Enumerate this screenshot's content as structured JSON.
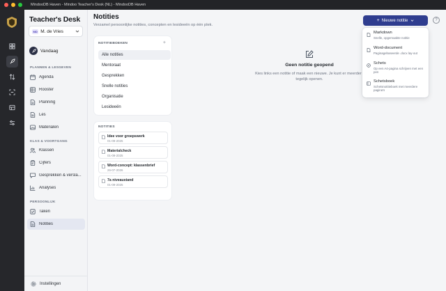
{
  "window": {
    "title": "MindooDB Haven - Mindoo Teacher's Desk (NL) - MindooDB Haven"
  },
  "sidebar": {
    "brand": "Teacher's Desk",
    "user": {
      "initials": "MD",
      "name": "M. de Vries"
    },
    "today_label": "Vandaag",
    "sections": [
      {
        "title": "PLANNEN & LESGEVEN",
        "items": [
          {
            "label": "Agenda",
            "icon": "calendar-icon"
          },
          {
            "label": "Rooster",
            "icon": "grid-icon"
          },
          {
            "label": "Planning",
            "icon": "file-icon"
          },
          {
            "label": "Les",
            "icon": "file-icon"
          },
          {
            "label": "Materialen",
            "icon": "image-icon"
          }
        ]
      },
      {
        "title": "KLAS & VOORTGANG",
        "items": [
          {
            "label": "Klassen",
            "icon": "users-icon"
          },
          {
            "label": "Cijfers",
            "icon": "clipboard-icon"
          },
          {
            "label": "Gesprekken & versla...",
            "icon": "chat-icon"
          },
          {
            "label": "Analyses",
            "icon": "chart-icon"
          }
        ]
      },
      {
        "title": "PERSOONLIJK",
        "items": [
          {
            "label": "Taken",
            "icon": "checkbox-icon"
          },
          {
            "label": "Notities",
            "icon": "note-icon",
            "active": true
          }
        ]
      }
    ],
    "settings_label": "Instellingen"
  },
  "main": {
    "title": "Notities",
    "subtitle": "Verzamel persoonlijke notities, concepten en lesideeën op één plek.",
    "new_note_button": "Nieuwe notitie",
    "help_label": "?",
    "folders": {
      "heading": "NOTITIEBOEKEN",
      "add_label": "+",
      "items": [
        "Alle notities",
        "Mentoraat",
        "Gesprekken",
        "Snelle notities",
        "Organisatie",
        "Lesideeën"
      ],
      "active_index": 0
    },
    "notes": {
      "heading": "NOTITIES",
      "items": [
        {
          "title": "Idee voor groepswerk",
          "date": "01-09-2025"
        },
        {
          "title": "Materialcheck",
          "date": "01-09-2025"
        },
        {
          "title": "Word-concept: klassenbrief",
          "date": "26-07-2026"
        },
        {
          "title": "7a niveaustand",
          "date": "01-09-2025"
        }
      ]
    },
    "empty_state": {
      "title": "Geen notitie geopend",
      "text": "Kies links een notitie of maak een nieuwe. Je kunt er meerdere tegelijk openen."
    },
    "new_menu": {
      "items": [
        {
          "title": "Markdown",
          "desc": "Snelle, opgemaakte notitie"
        },
        {
          "title": "Word-document",
          "desc": "Paginagebaseerde .docx lay-out"
        },
        {
          "title": "Schets",
          "desc": "Op een A4-pagina schrijven met een pen"
        },
        {
          "title": "Schetsboek",
          "desc": "Schetsnotitieboek met meerdere pagina's"
        }
      ]
    }
  },
  "colors": {
    "accent": "#2f3d8f",
    "rail": "#26272b",
    "sidebar_bg": "#f3f4f6",
    "main_bg": "#f4f5f7"
  }
}
